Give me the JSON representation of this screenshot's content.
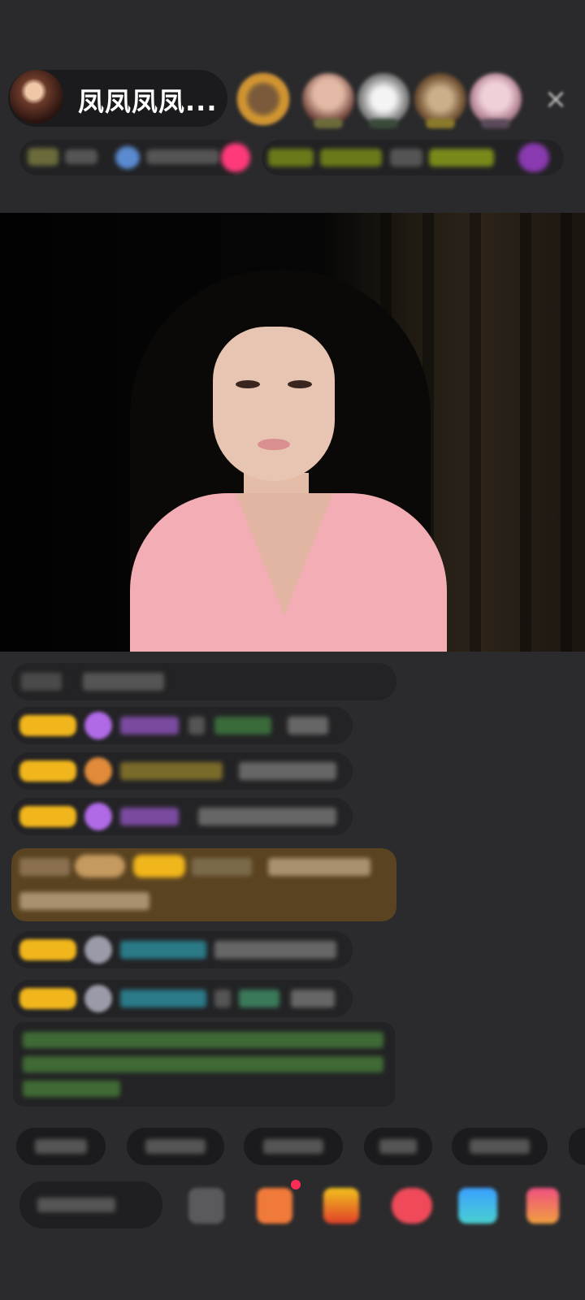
{
  "anchor": {
    "name": "凤凤凤凤..."
  },
  "colors": {
    "accent_gold": "#f1b61c",
    "chat_green": "#7bd46a",
    "chat_cyan": "#4fc7d6",
    "purple": "#b06ae6",
    "highlight_bubble": "#5a4321",
    "notification_red": "#ff2d55"
  },
  "icons": {
    "close": "close-icon",
    "diamond": "diamond-icon",
    "bag": "bag-icon",
    "emoji": "emoji-icon",
    "gift_box": "gift-box-icon"
  },
  "close_label": "×"
}
